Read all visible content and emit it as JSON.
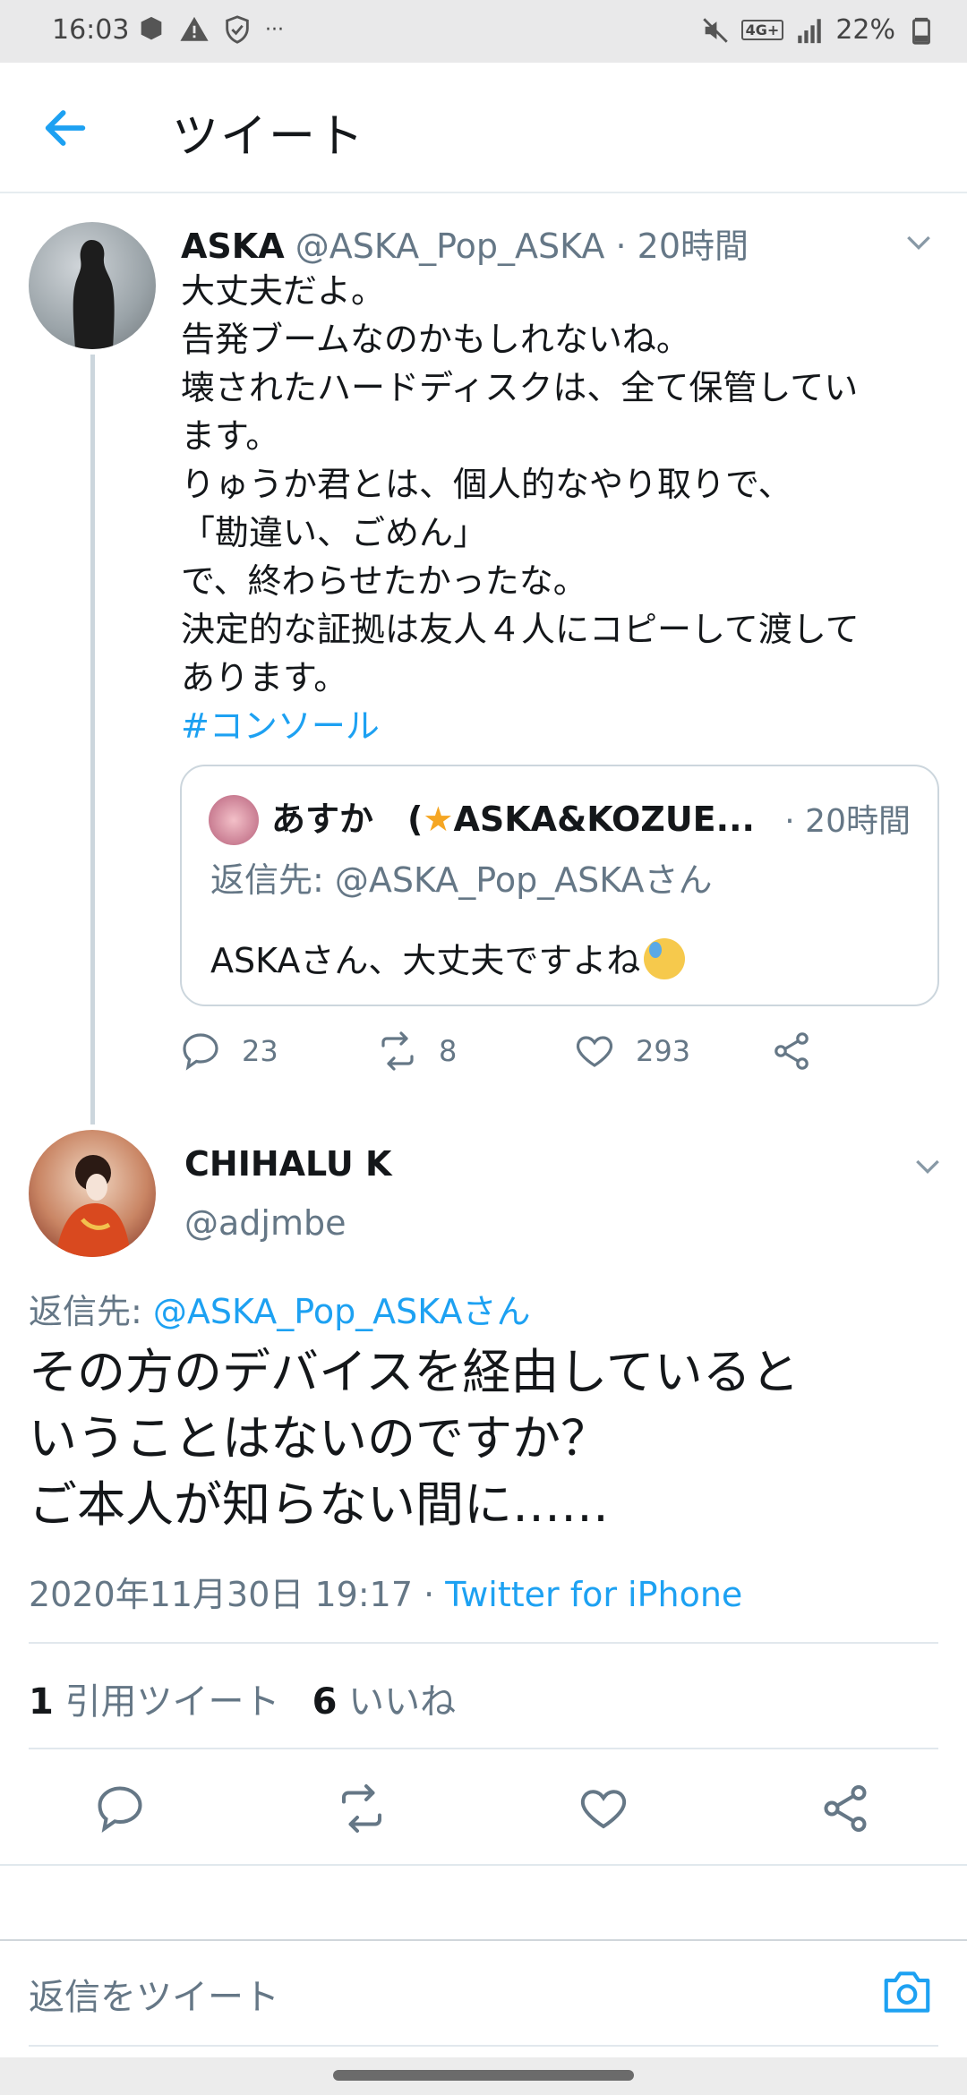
{
  "status_bar": {
    "time": "16:03",
    "dots": "···",
    "network": "4G+",
    "battery": "22%",
    "left_icons": [
      "app-notification-icon",
      "warning-icon",
      "shield-check-icon"
    ],
    "right_icons": [
      "mute-icon",
      "network-4g-icon",
      "signal-icon",
      "battery-icon"
    ]
  },
  "header": {
    "title": "ツイート",
    "back_icon": "back-arrow-icon"
  },
  "tweet1": {
    "name": "ASKA",
    "handle": "@ASKA_Pop_ASKA",
    "separator": " · ",
    "time": "20時間",
    "body_lines": [
      "大丈夫だよ。",
      "告発ブームなのかもしれないね。",
      "壊されたハードディスクは、全て保管してい",
      "ます。",
      "りゅうか君とは、個人的なやり取りで、",
      "「勘違い、ごめん」",
      "で、終わらせたかったな。",
      "決定的な証拠は友人４人にコピーして渡して",
      "あります。"
    ],
    "hashtag": "#コンソール",
    "quote": {
      "name_part1": "あすか　(",
      "star": "★",
      "name_part2": "ASKA&KOZUE...",
      "time": "· 20時間",
      "reply_prefix": "返信先: ",
      "reply_handle": "@ASKA_Pop_ASKAさん",
      "text": "ASKAさん、大丈夫ですよね"
    },
    "actions": {
      "replies": "23",
      "retweets": "8",
      "likes": "293"
    }
  },
  "tweet2": {
    "name": "CHIHALU K",
    "handle": "@adjmbe",
    "reply_prefix": "返信先: ",
    "reply_handle": "@ASKA_Pop_ASKAさん",
    "body_lines": [
      "その方のデバイスを経由していると",
      "いうことはないのですか？",
      "ご本人が知らない間に……"
    ],
    "date": "2020年11月30日 19:17",
    "meta_separator": " · ",
    "source": "Twitter for iPhone",
    "quote_count": "1",
    "quote_label": "引用ツイート",
    "like_count": "6",
    "like_label": "いいね"
  },
  "reply_bar": {
    "placeholder": "返信をツイート"
  },
  "colors": {
    "accent": "#1da1f2",
    "text_primary": "#14171a",
    "text_secondary": "#657786",
    "border": "#e1e8ed"
  }
}
